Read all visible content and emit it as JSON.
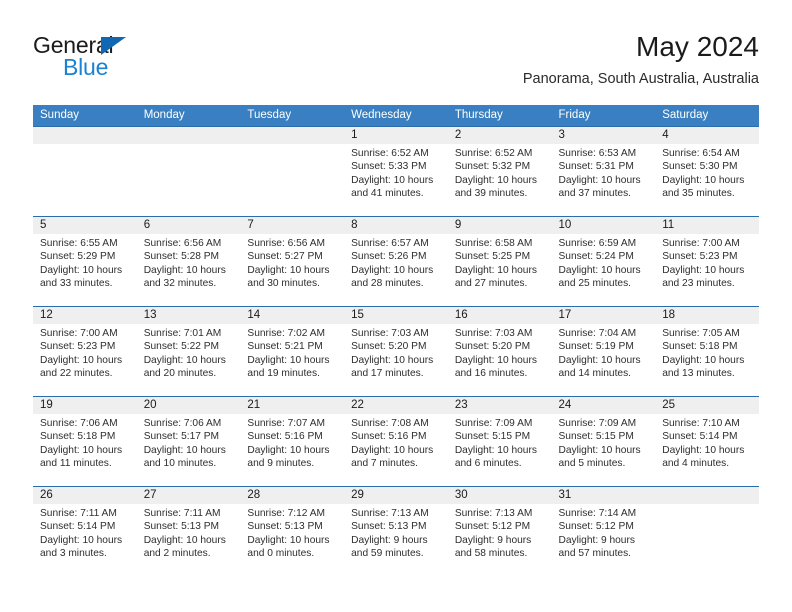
{
  "brand": {
    "name_part1": "General",
    "name_part2": "Blue",
    "logo_icon": "blue-triangle-logo"
  },
  "header": {
    "title": "May 2024",
    "subtitle": "Panorama, South Australia, Australia"
  },
  "colors": {
    "header_blue": "#3a7fc1",
    "row_divider_blue": "#2b6cad",
    "daynum_band": "#efefef",
    "brand_blue": "#1b82d2",
    "text": "#2e2e2e"
  },
  "weekday_headers": [
    "Sunday",
    "Monday",
    "Tuesday",
    "Wednesday",
    "Thursday",
    "Friday",
    "Saturday"
  ],
  "weeks": [
    [
      {
        "day": "",
        "empty": true
      },
      {
        "day": "",
        "empty": true
      },
      {
        "day": "",
        "empty": true
      },
      {
        "day": "1",
        "sunrise": "Sunrise: 6:52 AM",
        "sunset": "Sunset: 5:33 PM",
        "daylight1": "Daylight: 10 hours",
        "daylight2": "and 41 minutes."
      },
      {
        "day": "2",
        "sunrise": "Sunrise: 6:52 AM",
        "sunset": "Sunset: 5:32 PM",
        "daylight1": "Daylight: 10 hours",
        "daylight2": "and 39 minutes."
      },
      {
        "day": "3",
        "sunrise": "Sunrise: 6:53 AM",
        "sunset": "Sunset: 5:31 PM",
        "daylight1": "Daylight: 10 hours",
        "daylight2": "and 37 minutes."
      },
      {
        "day": "4",
        "sunrise": "Sunrise: 6:54 AM",
        "sunset": "Sunset: 5:30 PM",
        "daylight1": "Daylight: 10 hours",
        "daylight2": "and 35 minutes."
      }
    ],
    [
      {
        "day": "5",
        "sunrise": "Sunrise: 6:55 AM",
        "sunset": "Sunset: 5:29 PM",
        "daylight1": "Daylight: 10 hours",
        "daylight2": "and 33 minutes."
      },
      {
        "day": "6",
        "sunrise": "Sunrise: 6:56 AM",
        "sunset": "Sunset: 5:28 PM",
        "daylight1": "Daylight: 10 hours",
        "daylight2": "and 32 minutes."
      },
      {
        "day": "7",
        "sunrise": "Sunrise: 6:56 AM",
        "sunset": "Sunset: 5:27 PM",
        "daylight1": "Daylight: 10 hours",
        "daylight2": "and 30 minutes."
      },
      {
        "day": "8",
        "sunrise": "Sunrise: 6:57 AM",
        "sunset": "Sunset: 5:26 PM",
        "daylight1": "Daylight: 10 hours",
        "daylight2": "and 28 minutes."
      },
      {
        "day": "9",
        "sunrise": "Sunrise: 6:58 AM",
        "sunset": "Sunset: 5:25 PM",
        "daylight1": "Daylight: 10 hours",
        "daylight2": "and 27 minutes."
      },
      {
        "day": "10",
        "sunrise": "Sunrise: 6:59 AM",
        "sunset": "Sunset: 5:24 PM",
        "daylight1": "Daylight: 10 hours",
        "daylight2": "and 25 minutes."
      },
      {
        "day": "11",
        "sunrise": "Sunrise: 7:00 AM",
        "sunset": "Sunset: 5:23 PM",
        "daylight1": "Daylight: 10 hours",
        "daylight2": "and 23 minutes."
      }
    ],
    [
      {
        "day": "12",
        "sunrise": "Sunrise: 7:00 AM",
        "sunset": "Sunset: 5:23 PM",
        "daylight1": "Daylight: 10 hours",
        "daylight2": "and 22 minutes."
      },
      {
        "day": "13",
        "sunrise": "Sunrise: 7:01 AM",
        "sunset": "Sunset: 5:22 PM",
        "daylight1": "Daylight: 10 hours",
        "daylight2": "and 20 minutes."
      },
      {
        "day": "14",
        "sunrise": "Sunrise: 7:02 AM",
        "sunset": "Sunset: 5:21 PM",
        "daylight1": "Daylight: 10 hours",
        "daylight2": "and 19 minutes."
      },
      {
        "day": "15",
        "sunrise": "Sunrise: 7:03 AM",
        "sunset": "Sunset: 5:20 PM",
        "daylight1": "Daylight: 10 hours",
        "daylight2": "and 17 minutes."
      },
      {
        "day": "16",
        "sunrise": "Sunrise: 7:03 AM",
        "sunset": "Sunset: 5:20 PM",
        "daylight1": "Daylight: 10 hours",
        "daylight2": "and 16 minutes."
      },
      {
        "day": "17",
        "sunrise": "Sunrise: 7:04 AM",
        "sunset": "Sunset: 5:19 PM",
        "daylight1": "Daylight: 10 hours",
        "daylight2": "and 14 minutes."
      },
      {
        "day": "18",
        "sunrise": "Sunrise: 7:05 AM",
        "sunset": "Sunset: 5:18 PM",
        "daylight1": "Daylight: 10 hours",
        "daylight2": "and 13 minutes."
      }
    ],
    [
      {
        "day": "19",
        "sunrise": "Sunrise: 7:06 AM",
        "sunset": "Sunset: 5:18 PM",
        "daylight1": "Daylight: 10 hours",
        "daylight2": "and 11 minutes."
      },
      {
        "day": "20",
        "sunrise": "Sunrise: 7:06 AM",
        "sunset": "Sunset: 5:17 PM",
        "daylight1": "Daylight: 10 hours",
        "daylight2": "and 10 minutes."
      },
      {
        "day": "21",
        "sunrise": "Sunrise: 7:07 AM",
        "sunset": "Sunset: 5:16 PM",
        "daylight1": "Daylight: 10 hours",
        "daylight2": "and 9 minutes."
      },
      {
        "day": "22",
        "sunrise": "Sunrise: 7:08 AM",
        "sunset": "Sunset: 5:16 PM",
        "daylight1": "Daylight: 10 hours",
        "daylight2": "and 7 minutes."
      },
      {
        "day": "23",
        "sunrise": "Sunrise: 7:09 AM",
        "sunset": "Sunset: 5:15 PM",
        "daylight1": "Daylight: 10 hours",
        "daylight2": "and 6 minutes."
      },
      {
        "day": "24",
        "sunrise": "Sunrise: 7:09 AM",
        "sunset": "Sunset: 5:15 PM",
        "daylight1": "Daylight: 10 hours",
        "daylight2": "and 5 minutes."
      },
      {
        "day": "25",
        "sunrise": "Sunrise: 7:10 AM",
        "sunset": "Sunset: 5:14 PM",
        "daylight1": "Daylight: 10 hours",
        "daylight2": "and 4 minutes."
      }
    ],
    [
      {
        "day": "26",
        "sunrise": "Sunrise: 7:11 AM",
        "sunset": "Sunset: 5:14 PM",
        "daylight1": "Daylight: 10 hours",
        "daylight2": "and 3 minutes."
      },
      {
        "day": "27",
        "sunrise": "Sunrise: 7:11 AM",
        "sunset": "Sunset: 5:13 PM",
        "daylight1": "Daylight: 10 hours",
        "daylight2": "and 2 minutes."
      },
      {
        "day": "28",
        "sunrise": "Sunrise: 7:12 AM",
        "sunset": "Sunset: 5:13 PM",
        "daylight1": "Daylight: 10 hours",
        "daylight2": "and 0 minutes."
      },
      {
        "day": "29",
        "sunrise": "Sunrise: 7:13 AM",
        "sunset": "Sunset: 5:13 PM",
        "daylight1": "Daylight: 9 hours",
        "daylight2": "and 59 minutes."
      },
      {
        "day": "30",
        "sunrise": "Sunrise: 7:13 AM",
        "sunset": "Sunset: 5:12 PM",
        "daylight1": "Daylight: 9 hours",
        "daylight2": "and 58 minutes."
      },
      {
        "day": "31",
        "sunrise": "Sunrise: 7:14 AM",
        "sunset": "Sunset: 5:12 PM",
        "daylight1": "Daylight: 9 hours",
        "daylight2": "and 57 minutes."
      },
      {
        "day": "",
        "empty": true
      }
    ]
  ]
}
